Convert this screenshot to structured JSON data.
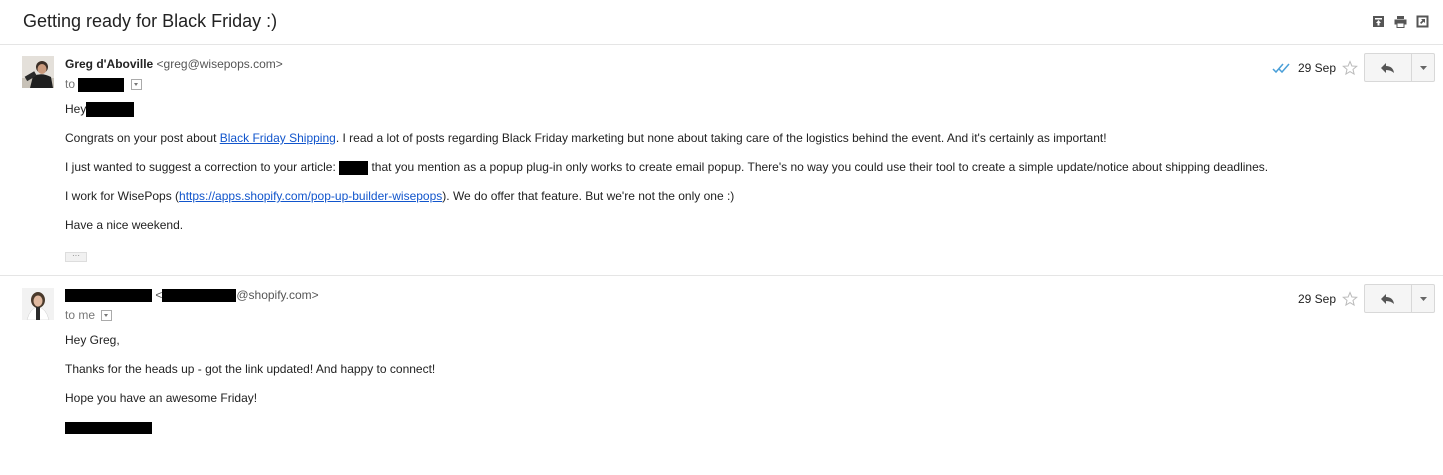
{
  "thread": {
    "subject": "Getting ready for Black Friday :)",
    "toolbar_icons": [
      "archive-icon",
      "print-icon",
      "new-window-icon"
    ]
  },
  "messages": [
    {
      "sender_name": "Greg d'Aboville",
      "sender_email": "<greg@wisepops.com>",
      "to_prefix": "to",
      "date": "29 Sep",
      "read_receipt_icon": "double-check-icon",
      "greeting": "Hey",
      "p1_pre": "Congrats on your post about ",
      "p1_link": "Black Friday Shipping",
      "p1_post": ". I read a lot of posts regarding Black Friday marketing but none about taking care of the logistics behind the event. And it's certainly as important!",
      "p2_pre": "I just wanted to suggest a correction to your article: ",
      "p2_post": " that you mention as a popup plug-in only works to create email popup. There's no way you could use their tool to create a simple update/notice about shipping deadlines.",
      "p3_pre": "I work for WisePops (",
      "p3_link": "https://apps.shopify.com/pop-up-builder-wisepops",
      "p3_post": "). We do offer that feature. But we're not the only one :)",
      "p4": "Have a nice weekend.",
      "trimmed_content": "···"
    },
    {
      "sender_lt": " <",
      "sender_email_suffix": "@shopify.com>",
      "to_line": "to me",
      "date": "29 Sep",
      "p1": "Hey Greg,",
      "p2": "Thanks for the heads up - got the link updated! And happy to connect!",
      "p3": "Hope you have an awesome Friday!"
    }
  ],
  "colors": {
    "link": "#1155cc",
    "divider": "#e5e5e5",
    "read_receipt": "#4a9fd8",
    "redaction": "#000000"
  }
}
